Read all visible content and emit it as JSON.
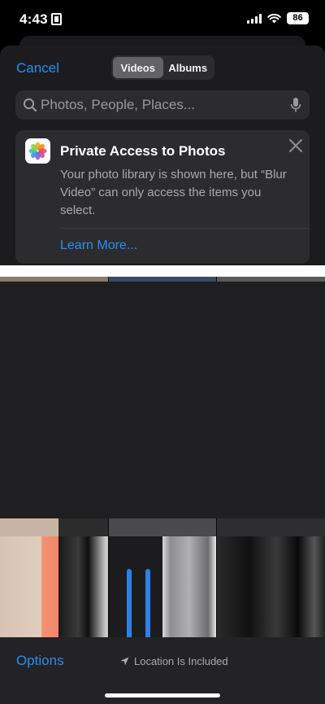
{
  "status_bar": {
    "time": "4:43",
    "battery": "86",
    "icons": [
      "sim-icon",
      "signal-icon",
      "wifi-icon",
      "battery-icon"
    ]
  },
  "header": {
    "cancel_label": "Cancel",
    "tabs": [
      {
        "label": "Videos",
        "selected": true
      },
      {
        "label": "Albums",
        "selected": false
      }
    ]
  },
  "search": {
    "placeholder": "Photos, People, Places...",
    "value": "",
    "icons": [
      "search-icon",
      "mic-icon"
    ]
  },
  "private_access_card": {
    "title": "Private Access to Photos",
    "body": "Your photo library is shown here, but “Blur Video” can only access the items you select.",
    "link_label": "Learn More...",
    "icons": [
      "photos-app-icon",
      "close-icon"
    ]
  },
  "bottom_bar": {
    "options_label": "Options",
    "location_text": "Location Is Included",
    "icons": [
      "location-arrow-icon"
    ]
  },
  "colors": {
    "accent": "#2e8bf5",
    "sheet_background": "#1c1c1e",
    "card_background": "#2c2c2e",
    "secondary_text": "#a9a9b0"
  }
}
